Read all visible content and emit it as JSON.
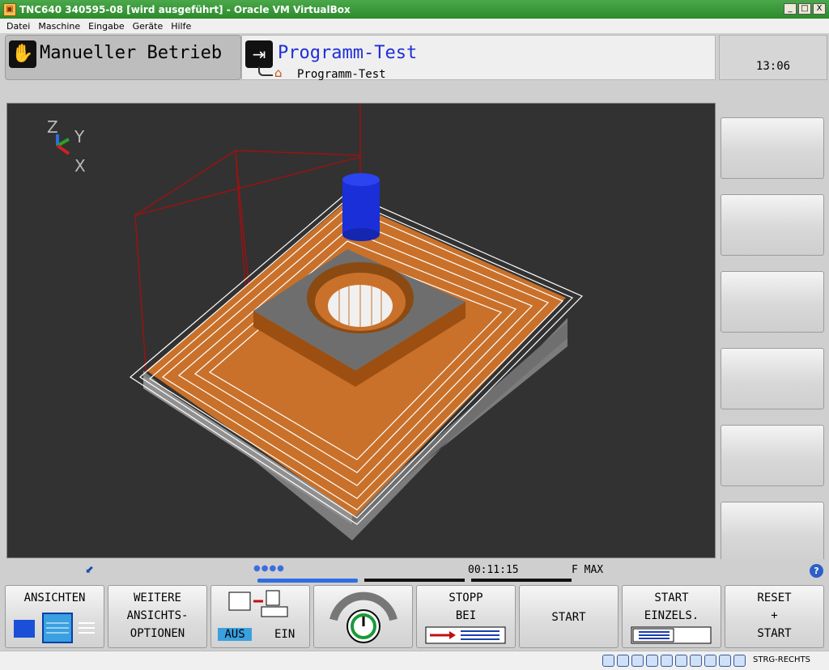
{
  "window": {
    "title": "TNC640 340595-08 [wird ausgeführt] - Oracle VM VirtualBox",
    "minimize_label": "_",
    "maximize_label": "□",
    "close_label": "X"
  },
  "menu": {
    "items": [
      "Datei",
      "Maschine",
      "Eingabe",
      "Geräte",
      "Hilfe"
    ]
  },
  "header": {
    "mode_left": "Manueller Betrieb",
    "mode_right": "Programm-Test",
    "sub_mode": "Programm-Test",
    "clock": "13:06"
  },
  "viewport": {
    "axes": {
      "z": "Z",
      "y": "Y",
      "x": "X"
    },
    "colors": {
      "background": "#323232",
      "workpiece_top": "#c9712a",
      "workpiece_side": "#8a8a8a",
      "tool": "#1a2fd8",
      "toolpath": "#ffffff",
      "rapid": "#b01010"
    }
  },
  "status": {
    "runtime": "00:11:15",
    "feed": "F MAX",
    "help": "?"
  },
  "softkeys": {
    "ansichten": [
      "ANSICHTEN"
    ],
    "weitere": [
      "WEITERE",
      "ANSICHTS-",
      "OPTIONEN"
    ],
    "werkzeug_aus": "AUS",
    "werkzeug_ein": "EIN",
    "stopp": [
      "STOPP",
      "BEI"
    ],
    "start": [
      "START"
    ],
    "start_einzel": [
      "START",
      "EINZELS."
    ],
    "reset": [
      "RESET",
      "+",
      "START"
    ]
  },
  "taskbar": {
    "host_key": "STRG-RECHTS"
  }
}
